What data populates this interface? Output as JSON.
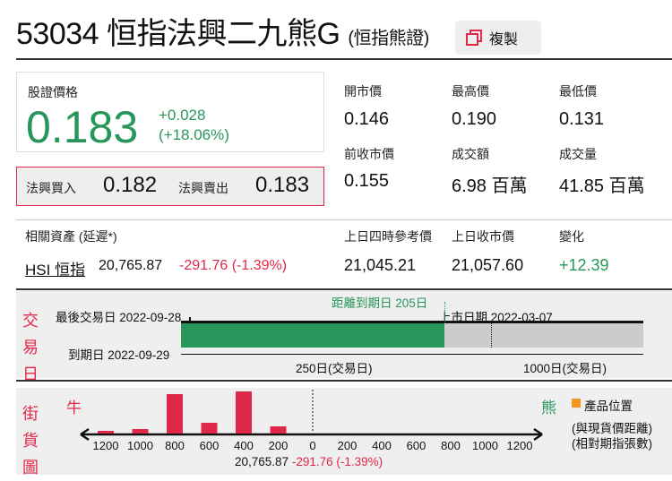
{
  "header": {
    "code": "53034",
    "name": "恒指法興二九熊G",
    "type": "(恒指熊證)",
    "copy_label": "複製"
  },
  "price": {
    "label": "股證價格",
    "value": "0.183",
    "change": "+0.028",
    "change_pct": "(+18.06%)"
  },
  "bidask": {
    "bid_label": "法興買入",
    "bid": "0.182",
    "ask_label": "法興賣出",
    "ask": "0.183"
  },
  "stats": [
    {
      "label": "開市價",
      "value": "0.146"
    },
    {
      "label": "最高價",
      "value": "0.190"
    },
    {
      "label": "最低價",
      "value": "0.131"
    },
    {
      "label": "前收市價",
      "value": "0.155"
    },
    {
      "label": "成交額",
      "value": "6.98 百萬"
    },
    {
      "label": "成交量",
      "value": "41.85 百萬"
    }
  ],
  "related": {
    "label": "相關資產 (延遲*)",
    "asset": "HSI 恒指",
    "value": "20,765.87",
    "change": "-291.76 (-1.39%)",
    "ref_label": "上日四時參考價",
    "ref": "21,045.21",
    "close_label": "上日收市價",
    "close": "21,057.60",
    "chg_label": "變化",
    "chg": "+12.39"
  },
  "trading": {
    "side_label": [
      "交",
      "易",
      "日"
    ],
    "last_trade": "最後交易日 2022-09-28",
    "expiry": "到期日 2022-09-29",
    "days_left": "距離到期日 205日",
    "listing": "上市日期 2022-03-07",
    "scale1": "250日(交易日)",
    "scale2": "1000日(交易日)",
    "elapsed_fraction": 0.57
  },
  "street": {
    "side_label": [
      "街",
      "貨",
      "圖"
    ],
    "bull": "牛",
    "bear": "熊",
    "legend": "產品位置",
    "note1": "(與現貨價距離)",
    "note2": "(相對期指張數)",
    "ticks": [
      "1200",
      "1000",
      "800",
      "600",
      "400",
      "200",
      "0",
      "200",
      "400",
      "600",
      "800",
      "1000",
      "1200"
    ],
    "bars": [
      3,
      5,
      44,
      12,
      47,
      8,
      0,
      0,
      0,
      0,
      0,
      0,
      0
    ],
    "spot": "20,765.87",
    "spot_change": "-291.76 (-1.39%)",
    "colors": {
      "bull": "#e0284a",
      "bear": "#27965a",
      "legend": "#f7941d"
    }
  }
}
